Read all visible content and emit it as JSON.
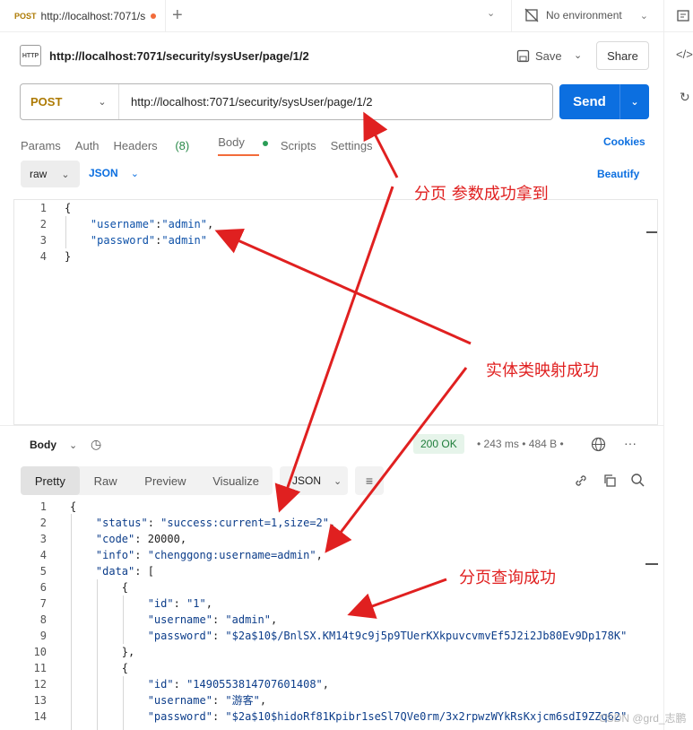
{
  "tab": {
    "method": "POST",
    "title": "http://localhost:7071/s"
  },
  "env": {
    "label": "No environment"
  },
  "request": {
    "title": "http://localhost:7071/security/sysUser/page/1/2",
    "save_label": "Save",
    "share_label": "Share",
    "method": "POST",
    "url": "http://localhost:7071/security/sysUser/page/1/2",
    "send_label": "Send"
  },
  "req_tabs": {
    "params": "Params",
    "auth": "Auth",
    "headers": "Headers",
    "headers_count": "(8)",
    "body": "Body",
    "scripts": "Scripts",
    "settings": "Settings",
    "cookies": "Cookies"
  },
  "body_opts": {
    "raw": "raw",
    "json": "JSON",
    "beautify": "Beautify"
  },
  "req_body": [
    "{",
    "    \"username\":\"admin\",",
    "    \"password\":\"admin\"",
    "}"
  ],
  "response": {
    "body_label": "Body",
    "status": "200 OK",
    "time": "243 ms",
    "size": "484 B",
    "views": [
      "Pretty",
      "Raw",
      "Preview",
      "Visualize"
    ],
    "format": "JSON",
    "lines": [
      "{",
      "    \"status\": \"success:current=1,size=2\",",
      "    \"code\": 20000,",
      "    \"info\": \"chenggong:username=admin\",",
      "    \"data\": [",
      "        {",
      "            \"id\": \"1\",",
      "            \"username\": \"admin\",",
      "            \"password\": \"$2a$10$/BnlSX.KM14t9c9j5p9TUerKXkpuvcvmvEf5J2i2Jb80Ev9Dp178K\"",
      "        },",
      "        {",
      "            \"id\": \"1490553814707601408\",",
      "            \"username\": \"游客\",",
      "            \"password\": \"$2a$10$hidoRf81Kpibr1seSl7QVe0rm/3x2rpwzWYkRsKxjcm6sdI9ZZq62\""
    ]
  },
  "annotations": [
    "分页 参数成功拿到",
    "实体类映射成功",
    "分页查询成功"
  ],
  "watermark": "CSDN @grd_志鹏"
}
